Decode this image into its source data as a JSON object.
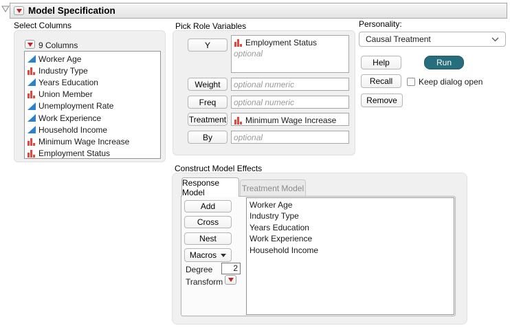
{
  "header": {
    "title": "Model Specification"
  },
  "select_columns": {
    "label": "Select Columns",
    "count_label": "9 Columns",
    "items": [
      {
        "name": "Worker Age",
        "type": "continuous"
      },
      {
        "name": "Industry Type",
        "type": "nominal"
      },
      {
        "name": "Years Education",
        "type": "continuous"
      },
      {
        "name": "Union Member",
        "type": "nominal"
      },
      {
        "name": "Unemployment Rate",
        "type": "continuous"
      },
      {
        "name": "Work Experience",
        "type": "continuous"
      },
      {
        "name": "Household Income",
        "type": "continuous"
      },
      {
        "name": "Minimum Wage Increase",
        "type": "nominal"
      },
      {
        "name": "Employment Status",
        "type": "nominal"
      }
    ]
  },
  "pick_roles": {
    "label": "Pick Role Variables",
    "rows": [
      {
        "button": "Y",
        "value": "Employment Status",
        "value_type": "nominal",
        "placeholder": "optional"
      },
      {
        "button": "Weight",
        "placeholder": "optional numeric"
      },
      {
        "button": "Freq",
        "placeholder": "optional numeric"
      },
      {
        "button": "Treatment",
        "value": "Minimum Wage Increase",
        "value_type": "nominal"
      },
      {
        "button": "By",
        "placeholder": "optional"
      }
    ]
  },
  "personality": {
    "label": "Personality:",
    "selected": "Causal Treatment",
    "help_label": "Help",
    "run_label": "Run",
    "recall_label": "Recall",
    "remove_label": "Remove",
    "keep_dialog_label": "Keep dialog open",
    "keep_dialog_checked": false
  },
  "model_effects": {
    "label": "Construct Model Effects",
    "tabs": [
      {
        "label": "Response Model",
        "active": true
      },
      {
        "label": "Treatment Model",
        "active": false
      }
    ],
    "add_label": "Add",
    "cross_label": "Cross",
    "nest_label": "Nest",
    "macros_label": "Macros",
    "degree_label": "Degree",
    "degree_value": "2",
    "transform_label": "Transform",
    "effects": [
      "Worker Age",
      "Industry Type",
      "Years Education",
      "Work Experience",
      "Household Income"
    ]
  },
  "colors": {
    "run_button": "#266e7e",
    "nominal_icon": "#e8453c",
    "continuous_icon": "#2e82cc",
    "accent_red": "#c42222"
  }
}
